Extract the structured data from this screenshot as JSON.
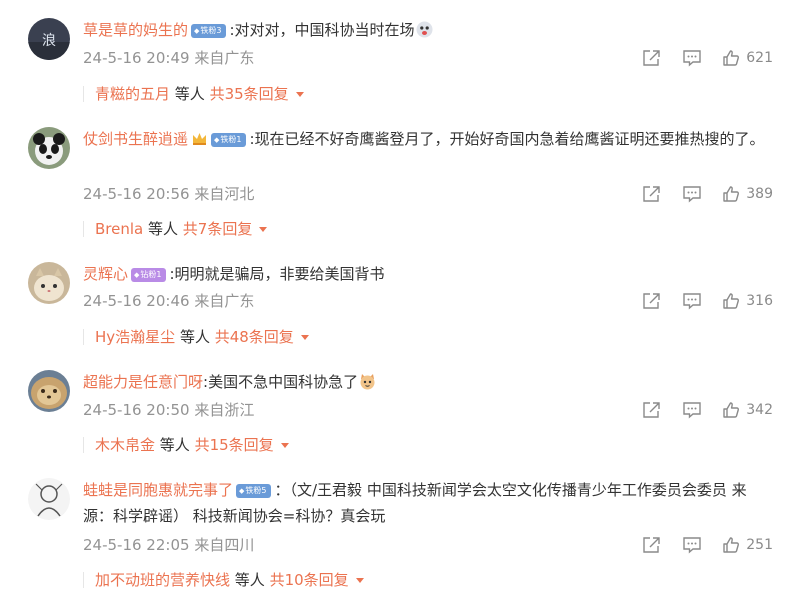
{
  "comments": [
    {
      "username": "草是草的妈生的",
      "badge": "铁粉3",
      "badge_color": "#6a9bd8",
      "text": ":对对对，中国科协当时在场",
      "emoji": "cheeky-face-emoji",
      "time": "24-5-16 20:49",
      "location": "来自广东",
      "likes": "621",
      "reply_user": "青糍的五月",
      "reply_mid": " 等人 ",
      "reply_count": "共35条回复"
    },
    {
      "username": "仗剑书生醉逍遥",
      "badge": "铁粉1",
      "badge_color": "#6a9bd8",
      "text": ":现在已经不好奇鹰酱登月了，开始好奇国内急着给鹰酱证明还要推热搜的了。",
      "time": "24-5-16 20:56",
      "location": "来自河北",
      "likes": "389",
      "reply_user": "Brenla",
      "reply_mid": " 等人 ",
      "reply_count": "共7条回复"
    },
    {
      "username": "灵辉心",
      "badge": "钻粉1",
      "badge_color": "#b98be6",
      "text": ":明明就是骗局，非要给美国背书",
      "time": "24-5-16 20:46",
      "location": "来自广东",
      "likes": "316",
      "reply_user": "Hy浩瀚星尘",
      "reply_mid": " 等人 ",
      "reply_count": "共48条回复"
    },
    {
      "username": "超能力是任意门呀",
      "text": ":美国不急中国科协急了",
      "emoji": "cat-face-emoji",
      "time": "24-5-16 20:50",
      "location": "来自浙江",
      "likes": "342",
      "reply_user": "木木帛金",
      "reply_mid": " 等人 ",
      "reply_count": "共15条回复"
    },
    {
      "username": "蛙蛙是同胞惠就完事了",
      "badge": "铁粉5",
      "badge_color": "#6a9bd8",
      "text": "：（文/王君毅 中国科技新闻学会太空文化传播青少年工作委员会委员 来源：科学辟谣） 科技新闻协会=科协？真会玩",
      "time": "24-5-16 22:05",
      "location": "来自四川",
      "likes": "251",
      "reply_user": "加不动班的营养快线",
      "reply_mid": " 等人 ",
      "reply_count": "共10条回复"
    }
  ],
  "colors": {
    "username": "#eb7350",
    "meta": "#939393",
    "text": "#333333"
  },
  "icons": [
    "share-icon",
    "comment-icon",
    "like-icon",
    "caret-down-icon"
  ]
}
